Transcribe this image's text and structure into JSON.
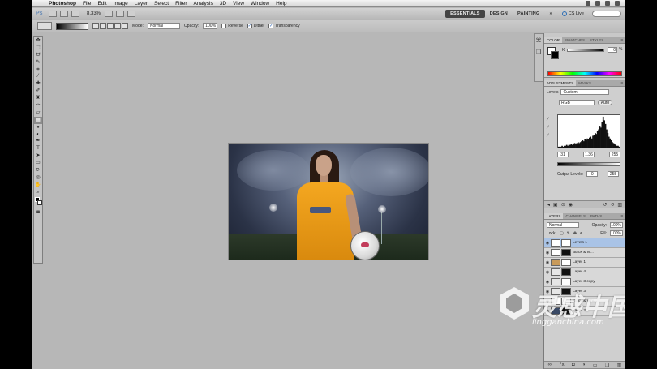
{
  "menubar": {
    "app_name": "Photoshop",
    "items": [
      "File",
      "Edit",
      "Image",
      "Layer",
      "Select",
      "Filter",
      "Analysis",
      "3D",
      "View",
      "Window",
      "Help"
    ]
  },
  "appbar": {
    "logo": "Ps",
    "zoom": "8.33%",
    "workspaces": [
      "ESSENTIALS",
      "DESIGN",
      "PAINTING"
    ],
    "more": "»",
    "cs_live": "CS Live"
  },
  "options": {
    "mode_label": "Mode:",
    "mode_value": "Normal",
    "opacity_label": "Opacity:",
    "opacity_value": "100%",
    "reverse": "Reverse",
    "dither": "Dither",
    "transparency": "Transparency"
  },
  "color_panel": {
    "tabs": [
      "COLOR",
      "SWATCHES",
      "STYLES"
    ],
    "k_label": "K",
    "k_value": "0",
    "k_unit": "%"
  },
  "adjustments": {
    "tabs": [
      "ADJUSTMENTS",
      "MASKS"
    ],
    "type": "Levels",
    "preset": "Custom",
    "channel": "RGB",
    "auto": "Auto",
    "input_black": "31",
    "input_gamma": "1.36",
    "input_white": "255",
    "output_label": "Output Levels:",
    "output_black": "0",
    "output_white": "255",
    "histogram": [
      1,
      1,
      1,
      2,
      1,
      2,
      2,
      3,
      2,
      3,
      3,
      4,
      3,
      4,
      5,
      4,
      5,
      6,
      5,
      6,
      7,
      8,
      7,
      9,
      8,
      10,
      9,
      11,
      12,
      10,
      13,
      14,
      16,
      15,
      18,
      20,
      24,
      22,
      28,
      34,
      30,
      26,
      20,
      16,
      12,
      10,
      8,
      6,
      5,
      4,
      3,
      2,
      2,
      1
    ]
  },
  "layers": {
    "tabs": [
      "LAYERS",
      "CHANNELS",
      "PATHS"
    ],
    "blend": "Normal",
    "opacity_label": "Opacity:",
    "opacity_value": "100%",
    "lock_label": "Lock:",
    "fill_label": "Fill:",
    "fill_value": "100%",
    "rows": [
      {
        "name": "Levels 1",
        "active": true
      },
      {
        "name": "Black & W...",
        "active": false
      },
      {
        "name": "Layer 1",
        "active": false
      },
      {
        "name": "Layer 4",
        "active": false
      },
      {
        "name": "Layer 3 copy",
        "active": false
      },
      {
        "name": "Layer 3",
        "active": false
      },
      {
        "name": "Black & Whi...",
        "active": false
      },
      {
        "name": "Layer 2",
        "active": false
      }
    ]
  },
  "watermark": {
    "cn": "灵感中国",
    "url": "lingganchina.com"
  },
  "colors": {
    "accent": "#2a6db5",
    "active_layer": "#a9c3e6"
  }
}
